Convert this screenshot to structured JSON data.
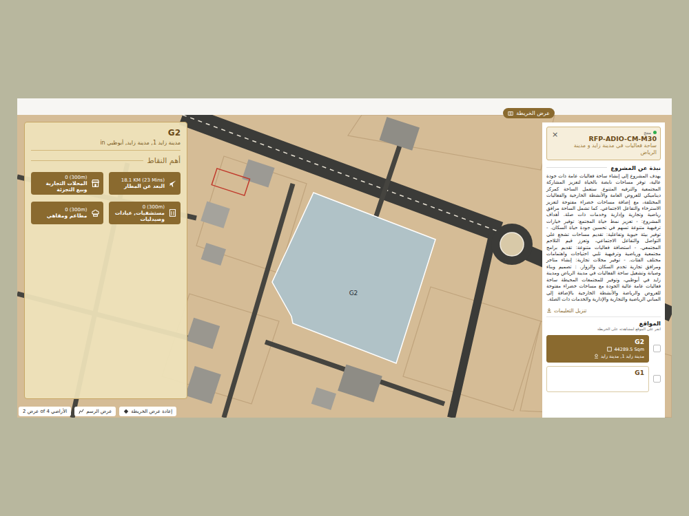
{
  "map_tag": "عرض الخريطة",
  "plot": {
    "label": "G2"
  },
  "plot_panel": {
    "title": "G2",
    "location": "in مدينة زايد 1, مدينة زايد, أبوظبي",
    "section_title": "أهم النقاط",
    "points": [
      {
        "kind": "airport",
        "value": "18.1 KM (23 Mins)",
        "label": "البعد عن المطار"
      },
      {
        "kind": "retail",
        "value": "0 (300m)",
        "label": "المحلات التجارية وبيع التجزئة"
      },
      {
        "kind": "health",
        "value": "0 (300m)",
        "label": "مستشفيات, عيادات وصيدليات"
      },
      {
        "kind": "food",
        "value": "0 (300m)",
        "label": "مطاعم ومقاهي"
      }
    ]
  },
  "map_controls": [
    {
      "kind": "count",
      "label": "عرض 2 of 4 الأراضي"
    },
    {
      "kind": "drawing",
      "label": "عرض الرسم"
    },
    {
      "kind": "recenter",
      "label": "إعادة عرض الخريطة"
    }
  ],
  "project_panel": {
    "status": "منتج",
    "code": "RFP-ADIO-CM-M30",
    "title": "ساحة فعاليات في مدينة زايد و مدينة الرياض",
    "close": "×",
    "about_title": "نبذة عن المشروع",
    "about_text": "يهدف المشروع إلى إنشاء ساحة فعاليات عامة ذات جودة عالية، توفر مساحات نابضة بالحياة لتعزيز المشاركة المجتمعية والترفيه المتنوع. ستعمل الساحة كمركز ديناميكي للعروض العامة والأنشطة الخارجية والفعاليات المختلفة، مع إضافة مساحات خضراء مفتوحة لتعزيز الاسترخاء والتفاعل الاجتماعي. كما تشمل الساحة مرافق رياضية وتجارية وإدارية وخدمات ذات صلة. أهداف المشروع: - تعزيز نمط حياة المجتمع: توفير خيارات ترفيهية متنوعة تسهم في تحسين جودة حياة السكان. - توفير بيئة حيوية وتفاعلية: تقديم مساحات تشجع على التواصل والتفاعل الاجتماعي، وتعزز قيم التلاحم المجتمعي. - استضافة فعاليات متنوعة: تقديم برامج مجتمعية ورياضية وترفيهية تلبي احتياجات واهتمامات مختلف الفئات. - توفير محلات تجارية: إنشاء متاجر ومرافق تجارية تخدم السكان والزوار. : تصميم وبناء وصيانة وتشغيل ساحة الفعاليات في مدينة الرياض ومدينة زايد في أبوظبي، وتوفير للمجتمعات المحيطة ساحة فعاليات عامة عالية الجودة مع مساحات خضراء مفتوحة للعروض والرياضة والأنشطة الخارجية بالإضافة إلى المباني الرياضية والتجارية والإدارية والخدمات ذات الصلة.",
    "download": "تنزيل التعليمات",
    "sites_title": "المواقع",
    "sites_hint": "انقر على الموقع لمشاهدته على الخريطة",
    "sites": [
      {
        "name": "G2",
        "area": "44289.5 Sqm",
        "location": "مدينة زايد 1, مدينة زايد",
        "selected": true,
        "checked": false
      },
      {
        "name": "G1",
        "selected": false,
        "checked": false
      }
    ]
  }
}
